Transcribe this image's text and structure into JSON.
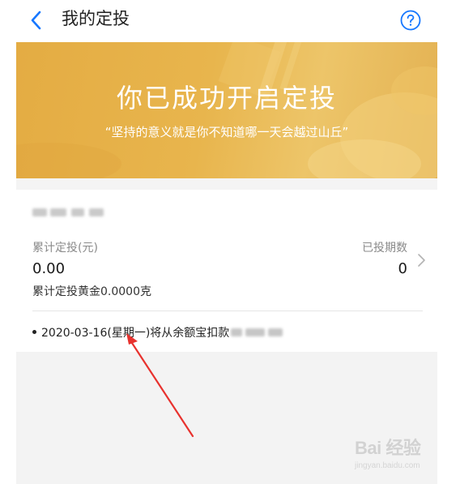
{
  "header": {
    "title": "我的定投",
    "back_icon": "chevron-left-icon",
    "help_icon": "question-circle-icon",
    "accent_color": "#1677ff"
  },
  "banner": {
    "title": "你已成功开启定投",
    "subtitle": "“坚持的意义就是你不知道哪一天会越过山丘”",
    "background_color": "#e8b54d"
  },
  "card": {
    "total_invested_label": "累计定投(元)",
    "total_invested_value": "0.00",
    "periods_label": "已投期数",
    "periods_value": "0",
    "gold_text": "累计定投黄金0.0000克",
    "schedule_text": "2020-03-16(星期一)将从余额宝扣款"
  },
  "annotation": {
    "arrow_color": "#e8322e"
  },
  "watermark": {
    "brand": "Bai 经验",
    "url": "jingyan.baidu.com"
  }
}
